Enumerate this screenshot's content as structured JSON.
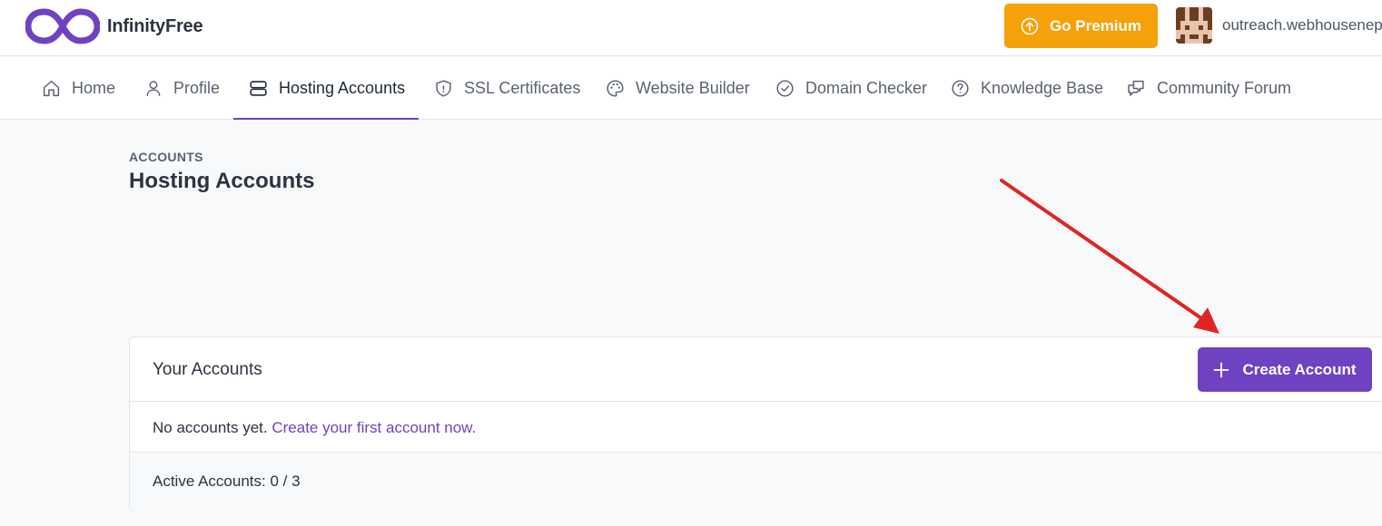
{
  "brand": {
    "name": "InfinityFree",
    "primary_color": "#6f42c1"
  },
  "header": {
    "premium_label": "Go Premium",
    "premium_color": "#f5a10a",
    "username": "outreach.webhousenep"
  },
  "nav": {
    "home": "Home",
    "profile": "Profile",
    "hosting": "Hosting Accounts",
    "ssl": "SSL Certificates",
    "builder": "Website Builder",
    "domain": "Domain Checker",
    "kb": "Knowledge Base",
    "forum": "Community Forum",
    "active": "Hosting Accounts"
  },
  "page": {
    "eyebrow": "ACCOUNTS",
    "title": "Hosting Accounts"
  },
  "accounts_card": {
    "title": "Your Accounts",
    "create_label": "Create Account",
    "empty_text": "No accounts yet.",
    "empty_link": "Create your first account now.",
    "footer_text": "Active Accounts: 0 / 3"
  },
  "annotation": {
    "arrow_color": "#e02424"
  }
}
